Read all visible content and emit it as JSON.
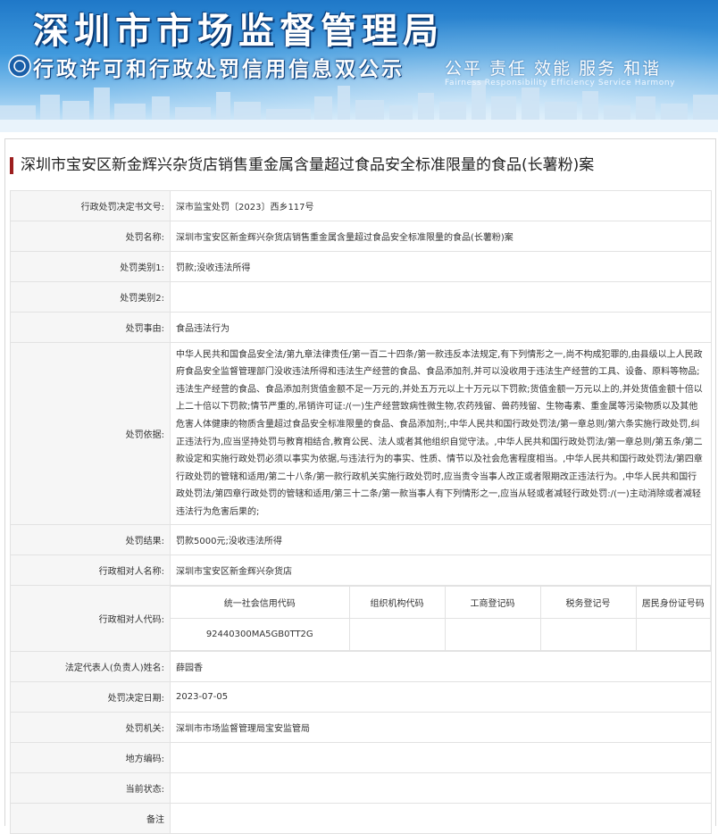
{
  "banner": {
    "title": "深圳市市场监督管理局",
    "subtitle": "行政许可和行政处罚信用信息双公示",
    "slogan": "公平  责任  效能  服务  和谐",
    "slogan_en": "Fairness  Responsibility  Efficiency  Service  Harmony",
    "logo_icon": "emblem-icon"
  },
  "case_title": "深圳市宝安区新金辉兴杂货店销售重金属含量超过食品安全标准限量的食品(长薯粉)案",
  "rows": {
    "decision_no": {
      "label": "行政处罚决定书文号:",
      "value": "深市监宝处罚〔2023〕西乡117号"
    },
    "penalty_name": {
      "label": "处罚名称:",
      "value": "深圳市宝安区新金辉兴杂货店销售重金属含量超过食品安全标准限量的食品(长薯粉)案"
    },
    "category1": {
      "label": "处罚类别1:",
      "value": "罚款;没收违法所得"
    },
    "category2": {
      "label": "处罚类别2:",
      "value": ""
    },
    "reason": {
      "label": "处罚事由:",
      "value": "食品违法行为"
    },
    "basis": {
      "label": "处罚依据:",
      "value": "中华人民共和国食品安全法/第九章法律责任/第一百二十四条/第一款违反本法规定,有下列情形之一,尚不构成犯罪的,由县级以上人民政府食品安全监督管理部门没收违法所得和违法生产经营的食品、食品添加剂,并可以没收用于违法生产经营的工具、设备、原料等物品;违法生产经营的食品、食品添加剂货值金额不足一万元的,并处五万元以上十万元以下罚款;货值金额一万元以上的,并处货值金额十倍以上二十倍以下罚款;情节严重的,吊销许可证:/(一)生产经营致病性微生物,农药残留、兽药残留、生物毒素、重金属等污染物质以及其他危害人体健康的物质含量超过食品安全标准限量的食品、食品添加剂;,中华人民共和国行政处罚法/第一章总则/第六条实施行政处罚,纠正违法行为,应当坚持处罚与教育相结合,教育公民、法人或者其他组织自觉守法。,中华人民共和国行政处罚法/第一章总则/第五条/第二款设定和实施行政处罚必须以事实为依据,与违法行为的事实、性质、情节以及社会危害程度相当。,中华人民共和国行政处罚法/第四章行政处罚的管辖和适用/第二十八条/第一款行政机关实施行政处罚时,应当责令当事人改正或者限期改正违法行为。,中华人民共和国行政处罚法/第四章行政处罚的管辖和适用/第三十二条/第一款当事人有下列情形之一,应当从轻或者减轻行政处罚:/(一)主动消除或者减轻违法行为危害后果的;"
    },
    "result": {
      "label": "处罚结果:",
      "value": "罚款5000元;没收违法所得"
    },
    "party_name": {
      "label": "行政相对人名称:",
      "value": "深圳市宝安区新金辉兴杂货店"
    },
    "party_code": {
      "label": "行政相对人代码:",
      "headers": [
        "统一社会信用代码",
        "组织机构代码",
        "工商登记码",
        "税务登记号",
        "居民身份证号码"
      ],
      "values": [
        "92440300MA5GB0TT2G",
        "",
        "",
        "",
        ""
      ]
    },
    "legal_rep": {
      "label": "法定代表人(负责人)姓名:",
      "value": "薛园香"
    },
    "decision_date": {
      "label": "处罚决定日期:",
      "value": "2023-07-05"
    },
    "authority": {
      "label": "处罚机关:",
      "value": "深圳市市场监督管理局宝安监管局"
    },
    "region_code": {
      "label": "地方编码:",
      "value": ""
    },
    "status": {
      "label": "当前状态:",
      "value": ""
    },
    "remark": {
      "label": "备注",
      "value": ""
    }
  }
}
